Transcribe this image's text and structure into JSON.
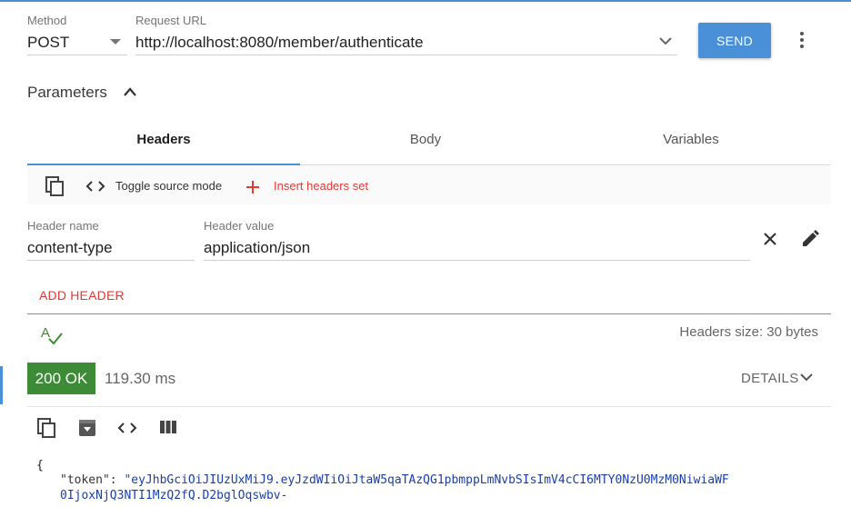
{
  "request": {
    "method_label": "Method",
    "method_value": "POST",
    "url_label": "Request URL",
    "url_value": "http://localhost:8080/member/authenticate",
    "send_label": "SEND"
  },
  "parameters": {
    "title": "Parameters",
    "tabs": [
      {
        "label": "Headers",
        "active": true
      },
      {
        "label": "Body",
        "active": false
      },
      {
        "label": "Variables",
        "active": false
      }
    ],
    "toolbar": {
      "toggle_source_label": "Toggle source mode",
      "insert_headers_label": "Insert headers set"
    },
    "header_row": {
      "name_label": "Header name",
      "name_value": "content-type",
      "value_label": "Header value",
      "value_value": "application/json"
    },
    "add_header_label": "ADD HEADER",
    "headers_size_text": "Headers size: 30 bytes"
  },
  "response": {
    "status": "200 OK",
    "time": "119.30 ms",
    "details_label": "DETAILS",
    "body": {
      "open_brace": "{",
      "key": "\"token\"",
      "colon": ": ",
      "value_line1": "\"eyJhbGciOiJIUzUxMiJ9.eyJzdWIiOiJtaW5qaTAzQG1pbmppLmNvbSIsImV4cCI6MTY0NzU0MzM0NiwiaWF",
      "value_line2": "0IjoxNjQ3NTI1MzQ2fQ.D2bglOqswbv-"
    }
  },
  "colors": {
    "accent": "#4a90d9",
    "status_ok": "#3d8b37",
    "danger": "#e53935",
    "json_string": "#1a3fa8"
  },
  "icons": {
    "method_dropdown": "caret-down-icon",
    "url_dropdown": "chevron-down-icon",
    "menu": "more-vert-icon",
    "collapse": "chevron-up-icon",
    "copy": "copy-icon",
    "code": "code-icon",
    "add": "plus-icon",
    "remove": "close-icon",
    "edit": "pencil-icon",
    "spellcheck": "spellcheck-icon",
    "save": "save-icon",
    "columns": "columns-icon"
  }
}
